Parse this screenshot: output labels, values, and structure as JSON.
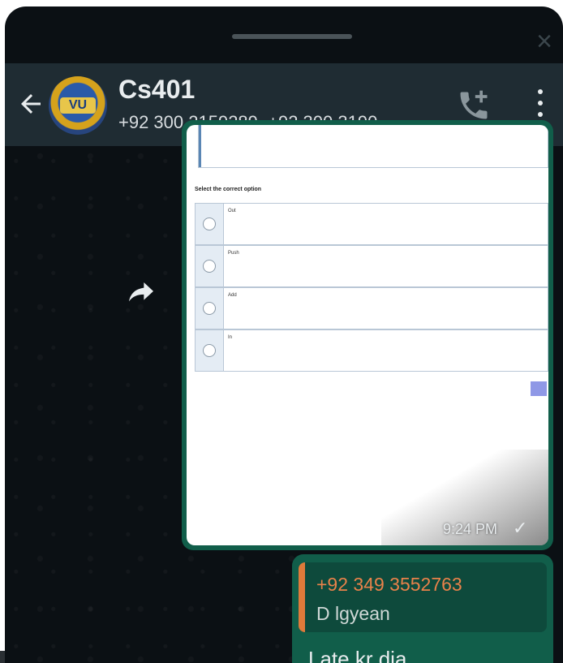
{
  "header": {
    "group_name": "Cs401",
    "participants": "+92 300 2159289, +92 300 3190...",
    "avatar_text": "VU"
  },
  "image_message": {
    "question": "Select the correct option",
    "options": [
      "Out",
      "Push",
      "Add",
      "In"
    ],
    "time": "9:24 PM",
    "status": "✓"
  },
  "reply_message": {
    "quoted_author": "+92 349 3552763",
    "quoted_text": "D lgyean",
    "text": "Late kr dia"
  },
  "icons": {
    "back": "arrow-left-icon",
    "call": "add-call-icon",
    "menu": "more-vert-icon",
    "forward": "forward-icon",
    "close": "close-icon"
  },
  "colors": {
    "header": "#1f2c33",
    "bubble": "#115e4a",
    "quote_author": "#e9824a",
    "chat_background": "#0b1014"
  }
}
